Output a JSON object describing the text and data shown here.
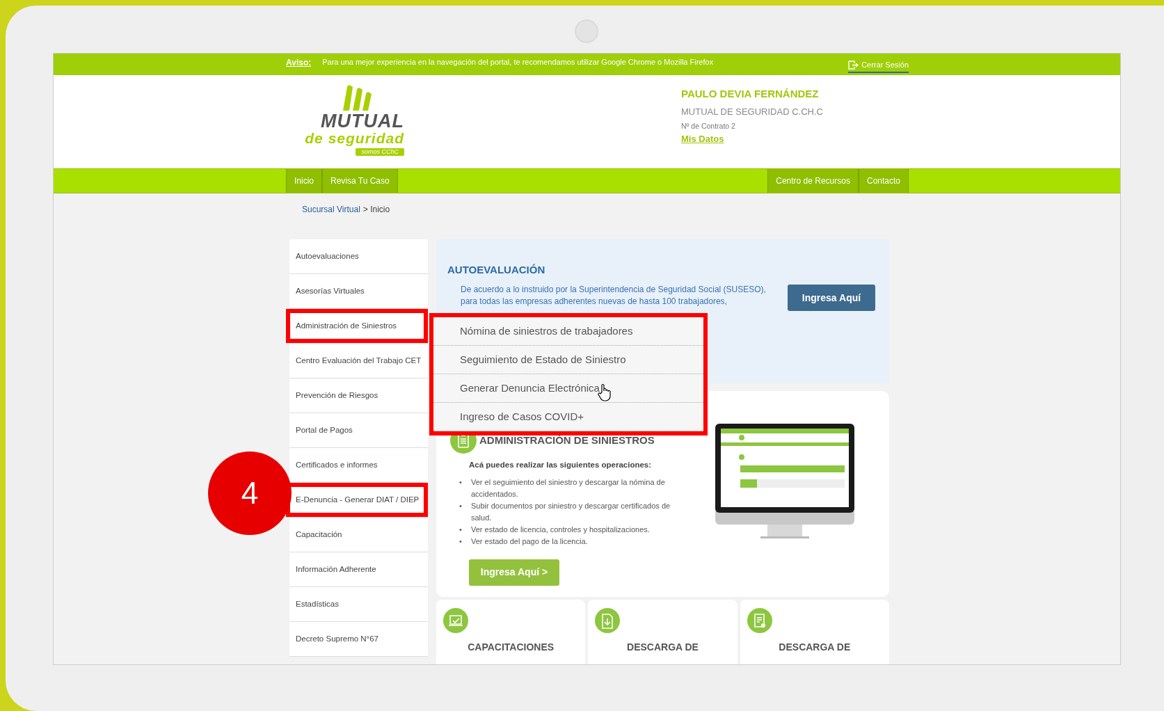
{
  "notice": {
    "label": "Aviso:",
    "text": "Para una mejor experiencia en la navegación del portal, te recomendamos utilizar Google Chrome o Mozilla Firefox",
    "logout": "Cerrar Sesión"
  },
  "logo": {
    "word": "MUTUAL",
    "subword": "de seguridad",
    "tagline": "somos CChC"
  },
  "user": {
    "name": "PAULO DEVIA FERNÁNDEZ",
    "company": "MUTUAL DE SEGURIDAD C.CH.C",
    "contract": "Nº de Contrato 2",
    "link": "Mis Datos"
  },
  "nav_left": [
    "Inicio",
    "Revisa Tu Caso"
  ],
  "nav_right": [
    "Centro de Recursos",
    "Contacto"
  ],
  "breadcrumb": {
    "link": "Sucursal Virtual",
    "current": "> Inicio"
  },
  "sidebar": {
    "items": [
      {
        "label": "Autoevaluaciones",
        "highlighted": false
      },
      {
        "label": "Asesorías Virtuales",
        "highlighted": false
      },
      {
        "label": "Administración de Siniestros",
        "highlighted": true
      },
      {
        "label": "Centro Evaluación del Trabajo CET",
        "highlighted": false
      },
      {
        "label": "Prevención de Riesgos",
        "highlighted": false
      },
      {
        "label": "Portal de Pagos",
        "highlighted": false
      },
      {
        "label": "Certificados e informes",
        "highlighted": false
      },
      {
        "label": "E-Denuncia - Generar DIAT / DIEP",
        "highlighted": true
      },
      {
        "label": "Capacitación",
        "highlighted": false
      },
      {
        "label": "Información Adherente",
        "highlighted": false
      },
      {
        "label": "Estadísticas",
        "highlighted": false
      },
      {
        "label": "Decreto Supremo N°67",
        "highlighted": false
      }
    ]
  },
  "dropdown": {
    "highlighted": true,
    "items": [
      {
        "label": "Nómina de siniestros de trabajadores",
        "hovered": false
      },
      {
        "label": "Seguimiento de Estado de Siniestro",
        "hovered": false
      },
      {
        "label": "Generar Denuncia Electrónica",
        "hovered": true
      },
      {
        "label": "Ingreso de Casos COVID+",
        "hovered": false
      }
    ]
  },
  "autoevaluacion": {
    "title": "AUTOEVALUACIÓN",
    "text": "De acuerdo a lo instruido por la Superintendencia de Seguridad Social (SUSESO), para todas las empresas adherentes nuevas de hasta 100 trabajadores,",
    "button": "Ingresa Aquí"
  },
  "admin": {
    "title": "ADMINISTRACIÓN DE SINIESTROS",
    "intro": "Acá puedes realizar las siguientes operaciones:",
    "bullets": [
      {
        "marker": "•",
        "text": "Ver el seguimiento del siniestro y descargar la nómina de accidentados."
      },
      {
        "marker": "•",
        "text": "Subir documentos por siniestro y descargar certificados de salud."
      },
      {
        "marker": "•",
        "text": "Ver estado de licencia, controles y hospitalizaciones."
      },
      {
        "marker": "•",
        "text": "Ver estado del pago de la licencia."
      }
    ],
    "button": "Ingresa Aquí >"
  },
  "cards": [
    {
      "kind": "training",
      "title": "CAPACITACIONES"
    },
    {
      "kind": "download",
      "title": "DESCARGA DE"
    },
    {
      "kind": "certificate",
      "title": "DESCARGA DE"
    }
  ],
  "annotation": {
    "step": "4"
  }
}
